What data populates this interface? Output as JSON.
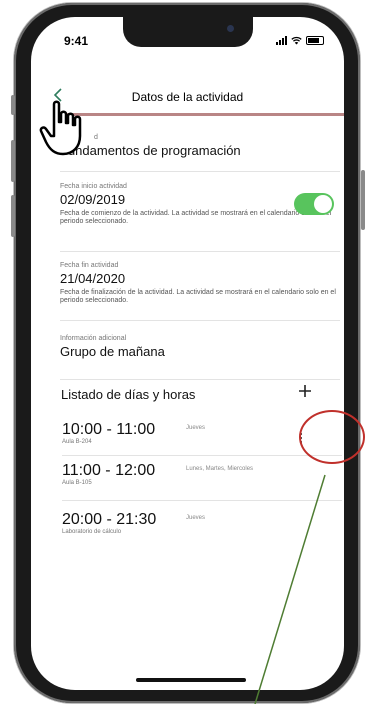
{
  "status": {
    "time": "9:41"
  },
  "header": {
    "title": "Datos de la actividad"
  },
  "activity": {
    "label_partial": "d",
    "name": "Fundamentos de programación"
  },
  "start": {
    "label": "Fecha inicio actividad",
    "value": "02/09/2019",
    "help": "Fecha de comienzo de la actividad. La actividad se mostrará en el calendario solo en el periodo seleccionado."
  },
  "end": {
    "label": "Fecha fin actividad",
    "value": "21/04/2020",
    "help": "Fecha de finalización de la actividad. La actividad se mostrará en el calendario solo en el periodo seleccionado."
  },
  "extra": {
    "label": "Información adicional",
    "value": "Grupo de mañana"
  },
  "schedule": {
    "title": "Listado de días y horas",
    "add_icon": "plus-icon",
    "items": [
      {
        "time": "10:00 - 11:00",
        "room": "Aula B-204",
        "days": "Jueves"
      },
      {
        "time": "11:00 - 12:00",
        "room": "Aula B-105",
        "days": "Lunes, Martes, Miercoles"
      },
      {
        "time": "20:00 - 21:30",
        "room": "Laboratorio de cálculo",
        "days": "Jueves"
      }
    ]
  },
  "colors": {
    "accent": "#2e7d5e",
    "toggle_on": "#58c45d",
    "header_line": "#b98585",
    "annotation_circle": "#c0302b",
    "annotation_line": "#4f7d33"
  }
}
